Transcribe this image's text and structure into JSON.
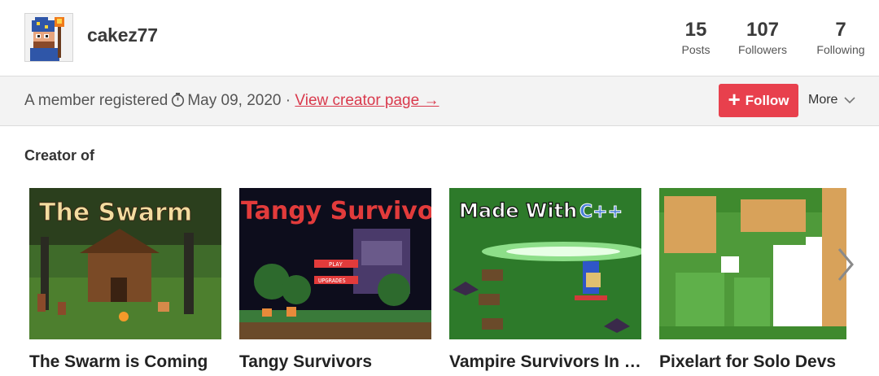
{
  "profile": {
    "username": "cakez77",
    "avatar_icon": "pixel-wizard-avatar-icon"
  },
  "stats": [
    {
      "value": "15",
      "label": "Posts"
    },
    {
      "value": "107",
      "label": "Followers"
    },
    {
      "value": "7",
      "label": "Following"
    }
  ],
  "info": {
    "registered_prefix": "A member registered",
    "clock_icon": "stopwatch-icon",
    "date": "May 09, 2020",
    "separator": "·",
    "creator_link": "View creator page →"
  },
  "actions": {
    "follow_label": "Follow",
    "more_label": "More"
  },
  "creator": {
    "section_title": "Creator of",
    "games": [
      {
        "title": "The Swarm is Coming",
        "thumb_text": "The Swarm"
      },
      {
        "title": "Tangy Survivors",
        "thumb_text": "Tangy Survivor",
        "menu_play": "PLAY",
        "menu_upgrades": "UPGRADES"
      },
      {
        "title": "Vampire Survivors In C...",
        "thumb_text_1": "Made With",
        "thumb_text_2": "C++"
      },
      {
        "title": "Pixelart for Solo Devs"
      }
    ]
  },
  "colors": {
    "accent": "#e8404d",
    "link": "#d9394c",
    "infobar_bg": "#f3f3f3"
  }
}
